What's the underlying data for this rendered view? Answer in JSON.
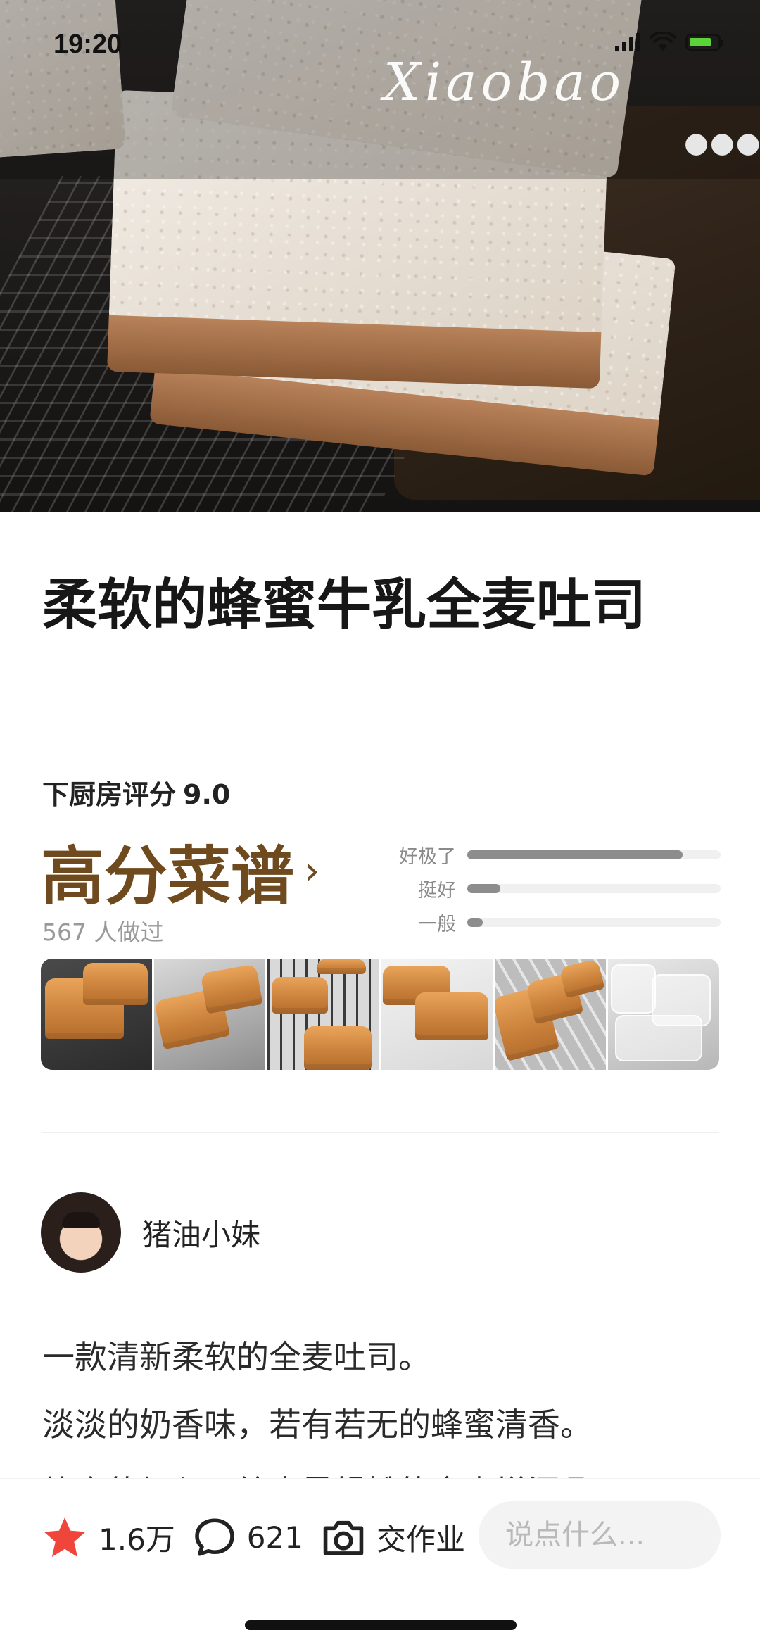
{
  "status_bar": {
    "time": "19:20"
  },
  "hero": {
    "watermark": "Xiaobao",
    "more_icon": "more-horizontal-icon"
  },
  "recipe": {
    "title": "柔软的蜂蜜牛乳全麦吐司",
    "rating_label": "下厨房评分",
    "rating_value": "9.0",
    "grade_label": "高分菜谱",
    "made_count": "567 人做过",
    "rating_bars": [
      {
        "label": "好极了",
        "fraction": 0.85
      },
      {
        "label": "挺好",
        "fraction": 0.13
      },
      {
        "label": "一般",
        "fraction": 0.06
      }
    ]
  },
  "author": {
    "name": "猪油小妹"
  },
  "description": {
    "lines": [
      "一款清新柔软的全麦吐司。",
      "淡淡的奶香味，若有若无的蜂蜜清香。",
      "蜂蜜的加入，给本是粗糙的全麦增添几"
    ]
  },
  "bottom_bar": {
    "favorite_count": "1.6万",
    "comment_count": "621",
    "homework_label": "交作业",
    "comment_placeholder": "说点什么...",
    "accent_color": "#f0453a"
  }
}
